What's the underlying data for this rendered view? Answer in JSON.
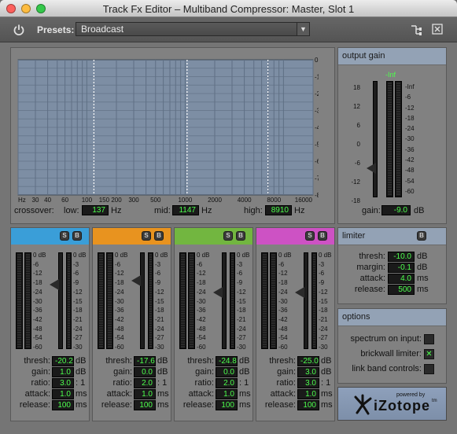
{
  "window": {
    "title": "Track Fx Editor – Multiband Compressor: Master, Slot 1"
  },
  "toolbar": {
    "power_icon": "power-icon",
    "presets_label": "Presets:",
    "preset_value": "Broadcast",
    "route_icon": "routing-icon",
    "close_icon": "close-window-icon"
  },
  "spectrum": {
    "db_ticks": [
      "0 dB",
      "-10",
      "-20",
      "-30",
      "-40",
      "-50",
      "-60",
      "-70",
      "-80"
    ],
    "freq_ticks": [
      "Hz",
      "30",
      "40",
      "60",
      "100",
      "150",
      "200",
      "300",
      "500",
      "1000",
      "2000",
      "4000",
      "8000",
      "16000"
    ],
    "crossover_label": "crossover:",
    "low_label": "low:",
    "low_value": "137",
    "low_unit": "Hz",
    "mid_label": "mid:",
    "mid_value": "1147",
    "mid_unit": "Hz",
    "high_label": "high:",
    "high_value": "8910",
    "high_unit": "Hz",
    "crossover_fractions": [
      0.257,
      0.573,
      0.847
    ]
  },
  "output_gain": {
    "title": "output gain",
    "peak_label": "-Inf",
    "left_scale": [
      "18",
      "12",
      "6",
      "0",
      "-6",
      "-12",
      "-18"
    ],
    "right_scale": [
      "-Inf",
      "-6",
      "-12",
      "-18",
      "-24",
      "-30",
      "-36",
      "-42",
      "-48",
      "-54",
      "-60"
    ],
    "gain_label": "gain:",
    "gain_value": "-9.0",
    "gain_unit": "dB"
  },
  "bands": [
    {
      "name": "band-1",
      "color": "#3a9ed8",
      "thresh": "-20.2",
      "gain": "1.0",
      "ratio": "3.0",
      "attack": "1.0",
      "release": "100"
    },
    {
      "name": "band-2",
      "color": "#e8931f",
      "thresh": "-17.6",
      "gain": "0.0",
      "ratio": "2.0",
      "attack": "1.0",
      "release": "100"
    },
    {
      "name": "band-3",
      "color": "#72b640",
      "thresh": "-24.8",
      "gain": "0.0",
      "ratio": "2.0",
      "attack": "1.0",
      "release": "100"
    },
    {
      "name": "band-4",
      "color": "#cd52c4",
      "thresh": "-25.0",
      "gain": "3.0",
      "ratio": "3.0",
      "attack": "1.0",
      "release": "100"
    }
  ],
  "band_labels": {
    "s": "S",
    "b": "B",
    "thresh": "thresh:",
    "gain": "gain:",
    "ratio": "ratio:",
    "attack": "attack:",
    "release": "release:",
    "db": "dB",
    "ratio_unit": ": 1",
    "ms": "ms"
  },
  "band_scale_left": [
    "0 dB",
    "-6",
    "-12",
    "-18",
    "-24",
    "-30",
    "-36",
    "-42",
    "-48",
    "-54",
    "-60"
  ],
  "band_scale_right": [
    "0 dB",
    "-3",
    "-6",
    "-9",
    "-12",
    "-15",
    "-18",
    "-21",
    "-24",
    "-27",
    "-30"
  ],
  "limiter": {
    "title": "limiter",
    "b": "B",
    "thresh_label": "thresh:",
    "thresh_value": "-10.0",
    "thresh_unit": "dB",
    "margin_label": "margin:",
    "margin_value": "-0.1",
    "margin_unit": "dB",
    "attack_label": "attack:",
    "attack_value": "4.0",
    "attack_unit": "ms",
    "release_label": "release:",
    "release_value": "500",
    "release_unit": "ms"
  },
  "options": {
    "title": "options",
    "spectrum_label": "spectrum on input:",
    "spectrum_checked": false,
    "brickwall_label": "brickwall limiter:",
    "brickwall_checked": true,
    "check_mark": "✕",
    "link_label": "link band controls:",
    "link_checked": false
  },
  "brand": {
    "powered_by": "powered by",
    "name": "iZotope",
    "tm": "tm"
  }
}
